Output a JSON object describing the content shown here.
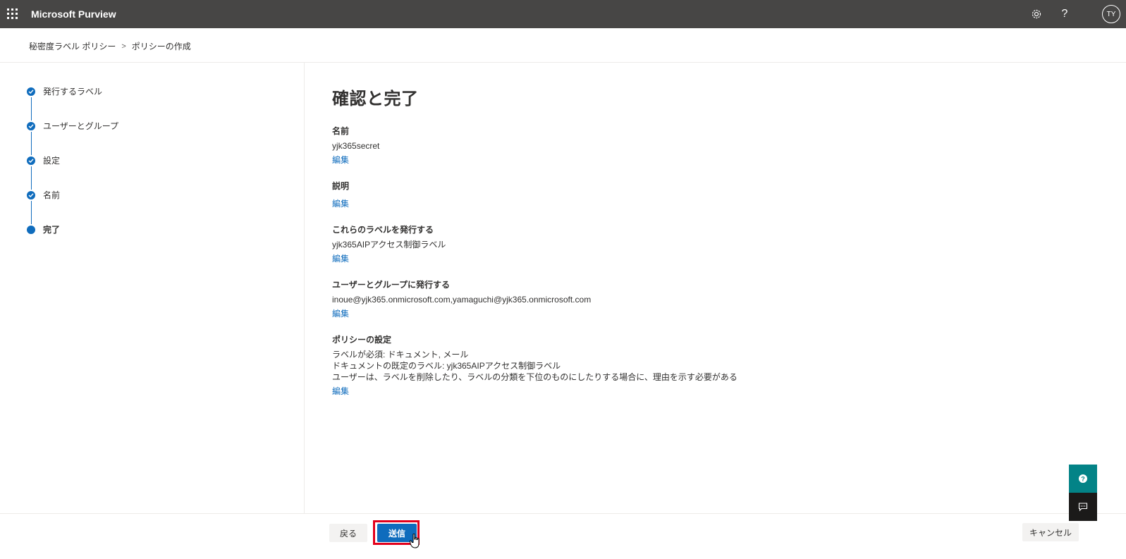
{
  "app": {
    "title": "Microsoft Purview",
    "user_initials": "TY"
  },
  "topbar": {
    "settings_icon": "gear-icon",
    "help_label": "?"
  },
  "breadcrumb": {
    "items": [
      "秘密度ラベル ポリシー",
      "ポリシーの作成"
    ],
    "separator": ">"
  },
  "steps": [
    {
      "label": "発行するラベル",
      "status": "completed"
    },
    {
      "label": "ユーザーとグループ",
      "status": "completed"
    },
    {
      "label": "設定",
      "status": "completed"
    },
    {
      "label": "名前",
      "status": "completed"
    },
    {
      "label": "完了",
      "status": "current"
    }
  ],
  "main": {
    "heading": "確認と完了",
    "sections": [
      {
        "title": "名前",
        "values": [
          "yjk365secret"
        ],
        "edit": "編集"
      },
      {
        "title": "説明",
        "values": [],
        "edit": "編集"
      },
      {
        "title": "これらのラベルを発行する",
        "values": [
          "yjk365AIPアクセス制御ラベル"
        ],
        "edit": "編集"
      },
      {
        "title": "ユーザーとグループに発行する",
        "values": [
          "inoue@yjk365.onmicrosoft.com,yamaguchi@yjk365.onmicrosoft.com"
        ],
        "edit": "編集"
      },
      {
        "title": "ポリシーの設定",
        "values": [
          "ラベルが必須: ドキュメント, メール",
          "ドキュメントの既定のラベル: yjk365AIPアクセス制御ラベル",
          "ユーザーは、ラベルを削除したり、ラベルの分類を下位のものにしたりする場合に、理由を示す必要がある"
        ],
        "edit": "編集"
      }
    ]
  },
  "footer": {
    "back_label": "戻る",
    "submit_label": "送信",
    "cancel_label": "キャンセル"
  },
  "colors": {
    "topbar": "#474645",
    "accent": "#0f6cbd",
    "highlight": "#e3001b",
    "help_button": "#038387"
  }
}
